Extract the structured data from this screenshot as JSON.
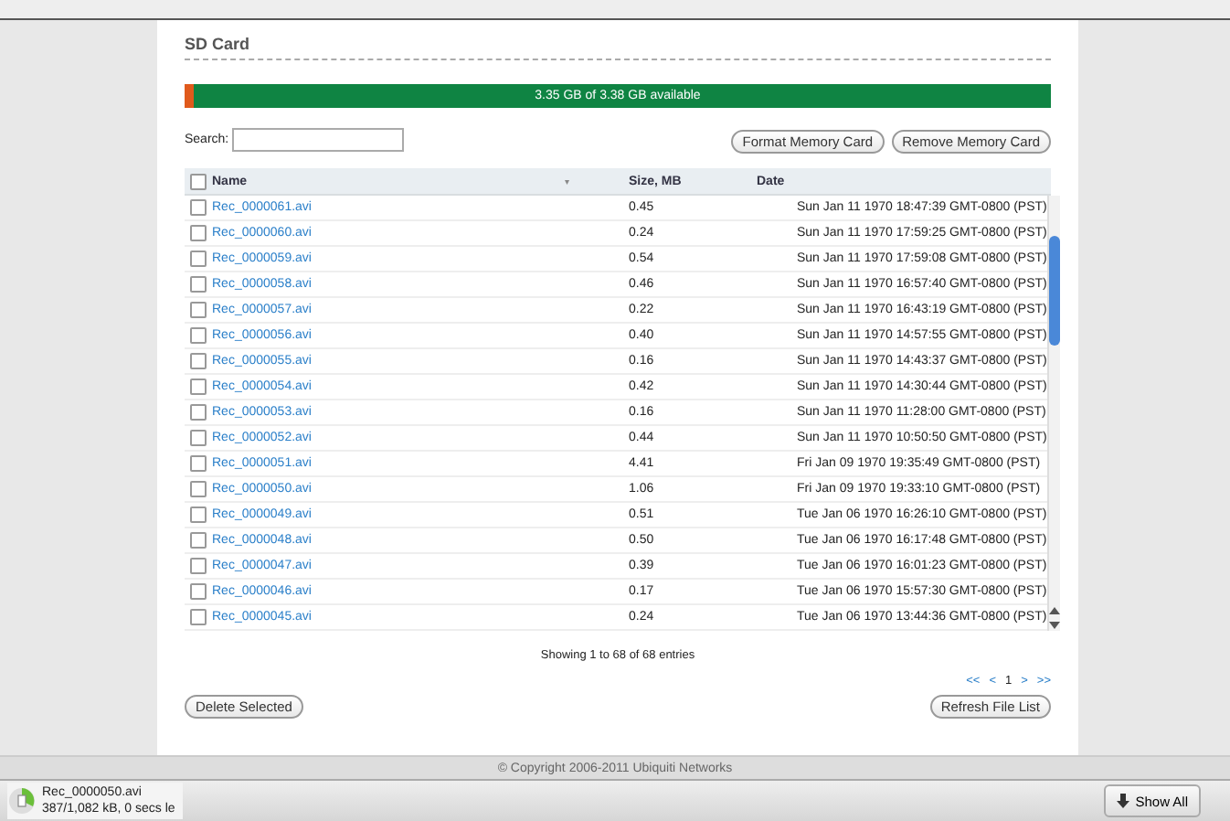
{
  "section_title": "SD Card",
  "storage": {
    "label": "3.35 GB of 3.38 GB available",
    "level": 0.01
  },
  "search": {
    "label": "Search:"
  },
  "buttons_top": [
    "Format Memory Card",
    "Remove Memory Card"
  ],
  "table": {
    "select_all": {
      "checked": false
    },
    "columns": [
      "Name",
      "Size, MB",
      "Date"
    ],
    "sort_indicator": "▾",
    "rows": [
      {
        "name": "Rec_0000061.avi",
        "size": "0.45",
        "date": "Sun Jan 11 1970 18:47:39 GMT-0800 (PST)",
        "checked": false
      },
      {
        "name": "Rec_0000060.avi",
        "size": "0.24",
        "date": "Sun Jan 11 1970 17:59:25 GMT-0800 (PST)",
        "checked": false
      },
      {
        "name": "Rec_0000059.avi",
        "size": "0.54",
        "date": "Sun Jan 11 1970 17:59:08 GMT-0800 (PST)",
        "checked": false
      },
      {
        "name": "Rec_0000058.avi",
        "size": "0.46",
        "date": "Sun Jan 11 1970 16:57:40 GMT-0800 (PST)",
        "checked": false
      },
      {
        "name": "Rec_0000057.avi",
        "size": "0.22",
        "date": "Sun Jan 11 1970 16:43:19 GMT-0800 (PST)",
        "checked": false
      },
      {
        "name": "Rec_0000056.avi",
        "size": "0.40",
        "date": "Sun Jan 11 1970 14:57:55 GMT-0800 (PST)",
        "checked": false
      },
      {
        "name": "Rec_0000055.avi",
        "size": "0.16",
        "date": "Sun Jan 11 1970 14:43:37 GMT-0800 (PST)",
        "checked": false
      },
      {
        "name": "Rec_0000054.avi",
        "size": "0.42",
        "date": "Sun Jan 11 1970 14:30:44 GMT-0800 (PST)",
        "checked": false
      },
      {
        "name": "Rec_0000053.avi",
        "size": "0.16",
        "date": "Sun Jan 11 1970 11:28:00 GMT-0800 (PST)",
        "checked": false
      },
      {
        "name": "Rec_0000052.avi",
        "size": "0.44",
        "date": "Sun Jan 11 1970 10:50:50 GMT-0800 (PST)",
        "checked": false
      },
      {
        "name": "Rec_0000051.avi",
        "size": "4.41",
        "date": "Fri Jan 09 1970 19:35:49 GMT-0800 (PST)",
        "checked": false
      },
      {
        "name": "Rec_0000050.avi",
        "size": "1.06",
        "date": "Fri Jan 09 1970 19:33:10 GMT-0800 (PST)",
        "checked": false
      },
      {
        "name": "Rec_0000049.avi",
        "size": "0.51",
        "date": "Tue Jan 06 1970 16:26:10 GMT-0800 (PST)",
        "checked": false
      },
      {
        "name": "Rec_0000048.avi",
        "size": "0.50",
        "date": "Tue Jan 06 1970 16:17:48 GMT-0800 (PST)",
        "checked": false
      },
      {
        "name": "Rec_0000047.avi",
        "size": "0.39",
        "date": "Tue Jan 06 1970 16:01:23 GMT-0800 (PST)",
        "checked": false
      },
      {
        "name": "Rec_0000046.avi",
        "size": "0.17",
        "date": "Tue Jan 06 1970 15:57:30 GMT-0800 (PST)",
        "checked": false
      },
      {
        "name": "Rec_0000045.avi",
        "size": "0.24",
        "date": "Tue Jan 06 1970 13:44:36 GMT-0800 (PST)",
        "checked": false
      }
    ]
  },
  "summary": "Showing 1 to 68 of 68 entries",
  "pagination": [
    {
      "label": "<<",
      "selected": false
    },
    {
      "label": "<",
      "selected": false
    },
    {
      "label": "1",
      "selected": true
    },
    {
      "label": ">",
      "selected": false
    },
    {
      "label": ">>",
      "selected": false
    }
  ],
  "buttons_bottom": [
    "Delete Selected",
    "Refresh File List"
  ],
  "copyright": "© Copyright 2006-2011 Ubiquiti Networks",
  "download": {
    "file": "Rec_0000050.avi",
    "status": "387/1,082 kB, 0 secs le",
    "show_all": "Show All"
  }
}
